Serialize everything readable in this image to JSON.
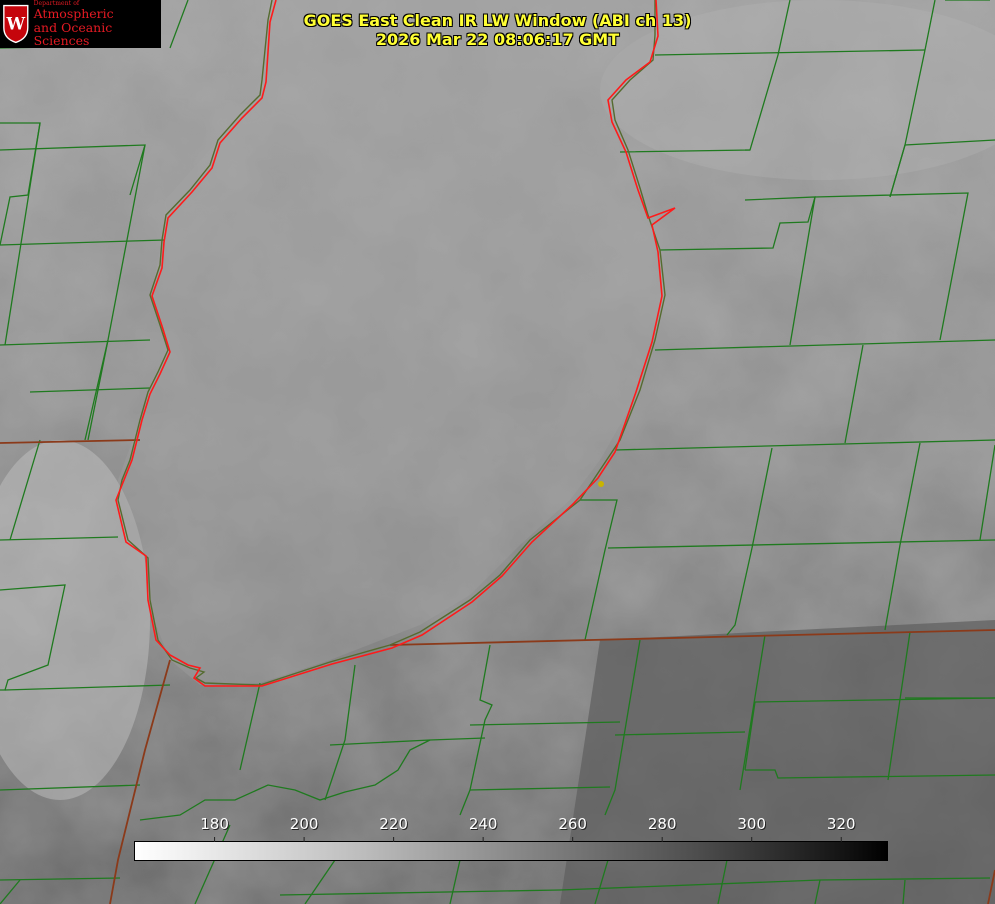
{
  "header": {
    "title_line1": "GOES East Clean IR LW Window (ABI ch 13)",
    "title_line2": "2026 Mar 22 08:06:17 GMT"
  },
  "logo": {
    "small_text": "Department of",
    "line1": "Atmospheric",
    "line2": "and Oceanic Sciences",
    "mark": "W"
  },
  "colorbar": {
    "min": 162,
    "max": 330,
    "ticks": [
      "180",
      "200",
      "220",
      "240",
      "260",
      "280",
      "300",
      "320"
    ],
    "tick_values": [
      180,
      200,
      220,
      240,
      260,
      280,
      300,
      320
    ]
  },
  "colors": {
    "title": "#ffff33",
    "county_lines": "#1f7a1f",
    "state_lines": "#8b3a1a",
    "lake_outline": "#ff1a1a",
    "station_dot": "#c9b400"
  },
  "map": {
    "feature": "lake-michigan-outline",
    "marker": "station-dot"
  }
}
